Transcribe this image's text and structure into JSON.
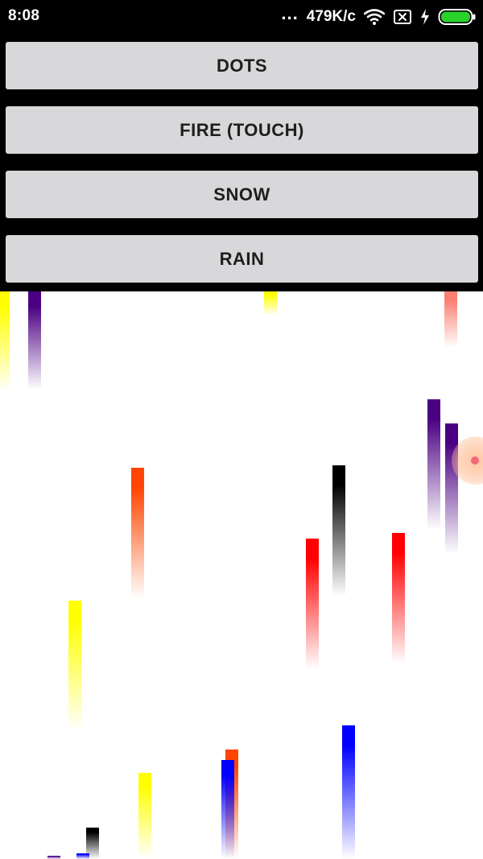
{
  "status_bar": {
    "time": "8:08",
    "more_indicator": "...",
    "network_speed": "479K/c",
    "icons": [
      "wifi-icon",
      "no-sim-icon",
      "charging-bolt-icon",
      "battery-icon"
    ],
    "battery_color": "#2bd12b"
  },
  "buttons": [
    {
      "label": "DOTS"
    },
    {
      "label": "FIRE (TOUCH)"
    },
    {
      "label": "SNOW"
    },
    {
      "label": "RAIN"
    }
  ],
  "rain": {
    "background": "#ffffff",
    "colors": {
      "yellow": "#ffff00",
      "purple": "#4b0082",
      "orange": "#ff4500",
      "red": "#ff0000",
      "black": "#000000",
      "blue": "#0000ff",
      "salmon": "#fa8072"
    }
  }
}
